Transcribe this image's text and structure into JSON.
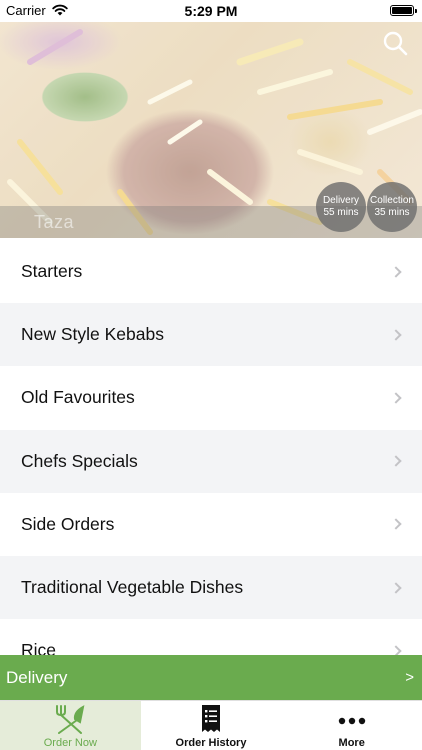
{
  "status_bar": {
    "carrier": "Carrier",
    "time": "5:29 PM"
  },
  "header": {
    "brand_name": "Taza",
    "search_icon": "search-icon",
    "delivery_badge": {
      "label": "Delivery",
      "time": "55 mins"
    },
    "collection_badge": {
      "label": "Collection",
      "time": "35 mins"
    }
  },
  "menu": {
    "categories": [
      {
        "label": "Starters"
      },
      {
        "label": "New Style Kebabs"
      },
      {
        "label": "Old Favourites"
      },
      {
        "label": "Chefs Specials"
      },
      {
        "label": "Side Orders"
      },
      {
        "label": "Traditional Vegetable Dishes"
      },
      {
        "label": "Rice"
      }
    ]
  },
  "delivery_bar": {
    "label": "Delivery",
    "arrow": ">"
  },
  "tab_bar": {
    "tabs": [
      {
        "label": "Order Now",
        "icon": "fork-knife-icon",
        "active": true
      },
      {
        "label": "Order History",
        "icon": "receipt-icon",
        "active": false
      },
      {
        "label": "More",
        "icon": "more-dots-icon",
        "active": false
      }
    ]
  },
  "colors": {
    "accent_green": "#6aab4e",
    "row_alt": "#f3f4f6",
    "active_tab_bg": "#e5ecd9"
  }
}
